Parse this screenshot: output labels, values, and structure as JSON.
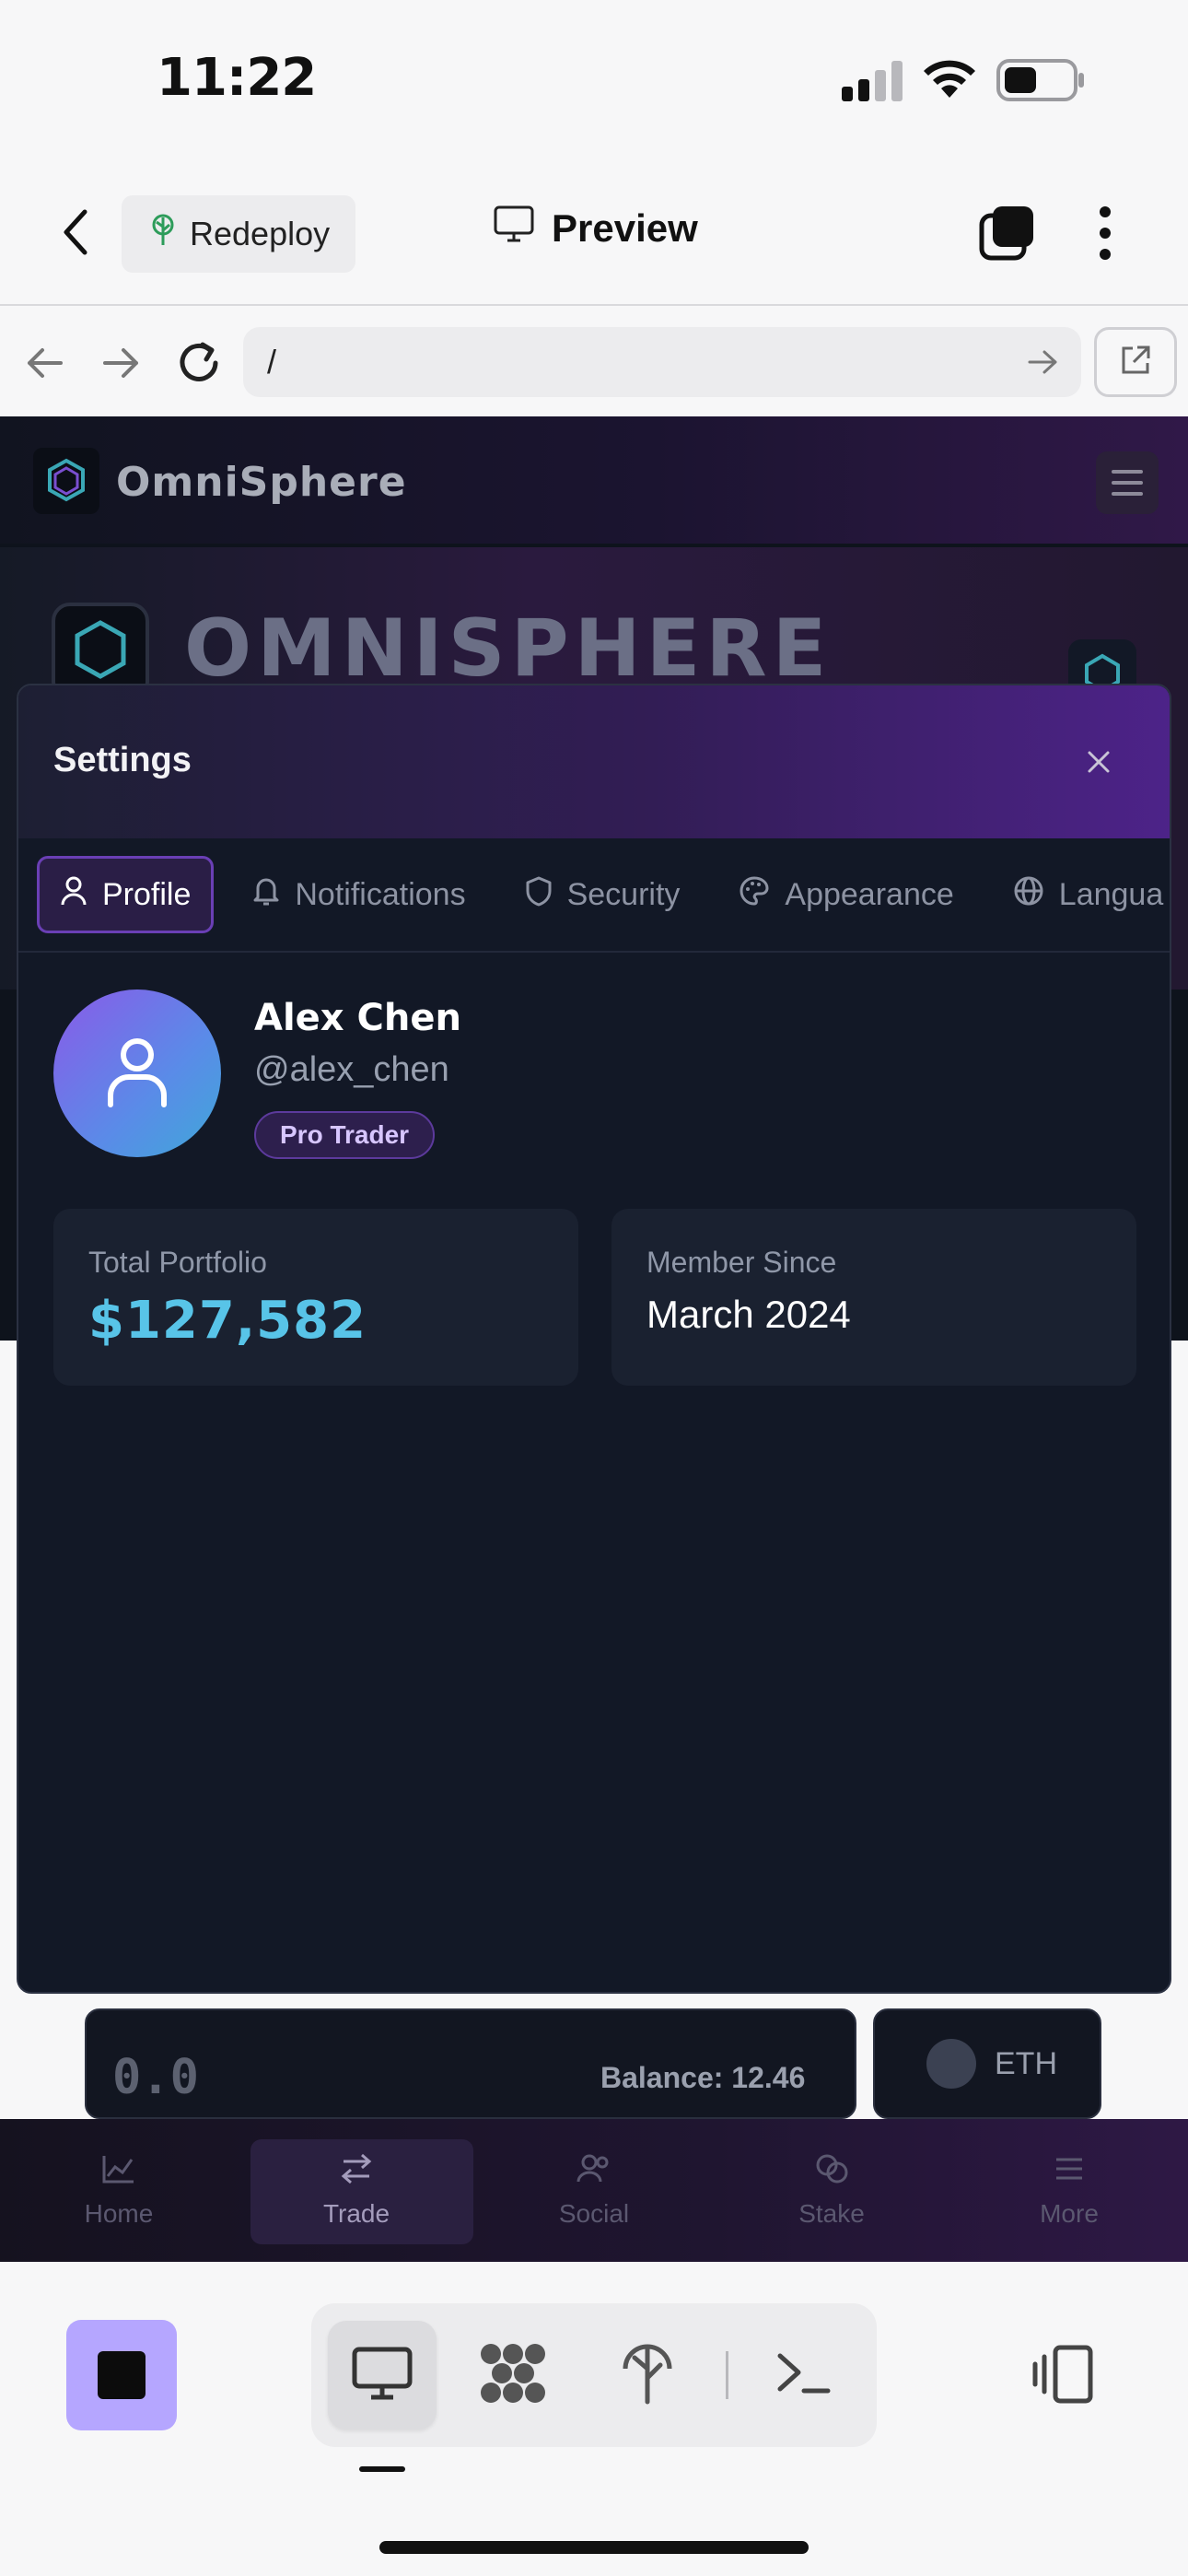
{
  "status_bar": {
    "time": "11:22"
  },
  "top_bar": {
    "redeploy_label": "Redeploy",
    "preview_label": "Preview"
  },
  "url_bar": {
    "value": "/"
  },
  "app": {
    "brand": "OmniSphere",
    "hero_title": "OMNISPHERE",
    "swap": {
      "amount": "0.0",
      "balance": "Balance: 12.46",
      "token": "ETH"
    },
    "bottom_nav": [
      {
        "label": "Home",
        "icon": "chart-icon"
      },
      {
        "label": "Trade",
        "icon": "swap-icon"
      },
      {
        "label": "Social",
        "icon": "users-icon"
      },
      {
        "label": "Stake",
        "icon": "coins-icon"
      },
      {
        "label": "More",
        "icon": "menu-icon"
      }
    ]
  },
  "settings": {
    "title": "Settings",
    "tabs": [
      {
        "label": "Profile",
        "icon": "user-icon",
        "active": true
      },
      {
        "label": "Notifications",
        "icon": "bell-icon",
        "active": false
      },
      {
        "label": "Security",
        "icon": "shield-icon",
        "active": false
      },
      {
        "label": "Appearance",
        "icon": "palette-icon",
        "active": false
      },
      {
        "label": "Langua",
        "icon": "globe-icon",
        "active": false
      }
    ],
    "profile": {
      "name": "Alex Chen",
      "handle": "@alex_chen",
      "badge": "Pro Trader",
      "portfolio_label": "Total Portfolio",
      "portfolio_value": "$127,582",
      "member_label": "Member Since",
      "member_value": "March 2024"
    }
  },
  "colors": {
    "accent": "#6a3fb5",
    "portfolio": "#58c4e8",
    "stop_button": "#b5a6ff"
  }
}
